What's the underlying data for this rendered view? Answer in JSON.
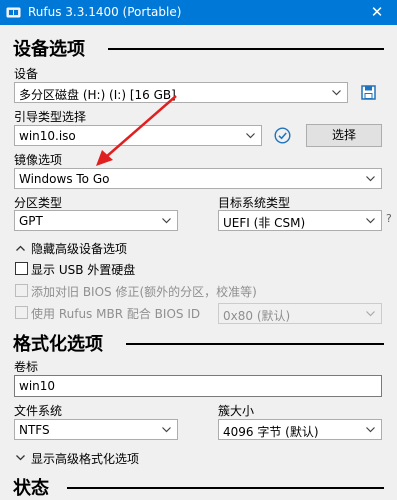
{
  "window": {
    "title": "Rufus 3.3.1400 (Portable)",
    "close_glyph": "✕",
    "accent": "#0078d7"
  },
  "drive_properties": {
    "heading": "设备选项",
    "device_label": "设备",
    "device_value": "多分区磁盘 (H:) (I:) [16 GB]",
    "boot_type_label": "引导类型选择",
    "boot_type_value": "win10.iso",
    "select_button": "选择",
    "image_option_label": "镜像选项",
    "image_option_value": "Windows To Go",
    "partition_scheme_label": "分区类型",
    "partition_scheme_value": "GPT",
    "target_system_label": "目标系统类型",
    "target_system_value": "UEFI (非 CSM)",
    "advanced_toggle": "隐藏高级设备选项",
    "list_usb_label": "显示 USB 外置硬盘",
    "bios_fix_label": "添加对旧 BIOS 修正(额外的分区，校准等)",
    "rufus_mbr_label": "使用 Rufus MBR 配合 BIOS ID",
    "bios_id_value": "0x80 (默认)"
  },
  "format_options": {
    "heading": "格式化选项",
    "volume_label_label": "卷标",
    "volume_label_value": "win10",
    "filesystem_label": "文件系统",
    "filesystem_value": "NTFS",
    "cluster_size_label": "簇大小",
    "cluster_size_value": "4096 字节 (默认)",
    "advanced_toggle": "显示高级格式化选项"
  },
  "status": {
    "heading": "状态"
  },
  "icons": {
    "save": "save-icon",
    "check": "check-circle-icon",
    "annotation_arrow_color": "#e02020"
  }
}
